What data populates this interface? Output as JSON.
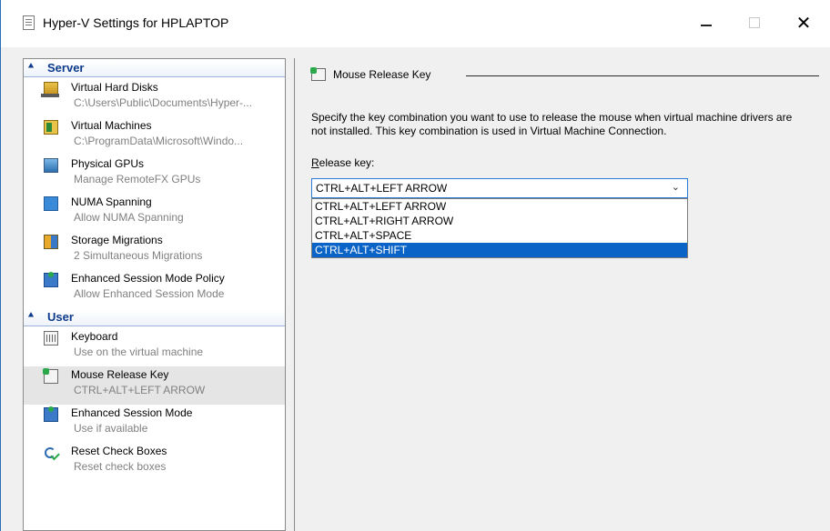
{
  "window": {
    "title": "Hyper-V Settings for HPLAPTOP",
    "close_glyph": "✕"
  },
  "sidebar": {
    "categories": [
      {
        "label": "Server",
        "icon": "chevron-up-icon"
      },
      {
        "label": "User",
        "icon": "chevron-up-icon"
      }
    ],
    "server_items": [
      {
        "title": "Virtual Hard Disks",
        "subtitle": "C:\\Users\\Public\\Documents\\Hyper-...",
        "icon": "hard-disk-icon"
      },
      {
        "title": "Virtual Machines",
        "subtitle": "C:\\ProgramData\\Microsoft\\Windo...",
        "icon": "virtual-machine-icon"
      },
      {
        "title": "Physical GPUs",
        "subtitle": "Manage RemoteFX GPUs",
        "icon": "gpu-icon"
      },
      {
        "title": "NUMA Spanning",
        "subtitle": "Allow NUMA Spanning",
        "icon": "numa-icon"
      },
      {
        "title": "Storage Migrations",
        "subtitle": "2 Simultaneous Migrations",
        "icon": "storage-migration-icon"
      },
      {
        "title": "Enhanced Session Mode Policy",
        "subtitle": "Allow Enhanced Session Mode",
        "icon": "enhanced-session-icon"
      }
    ],
    "user_items": [
      {
        "title": "Keyboard",
        "subtitle": "Use on the virtual machine",
        "icon": "keyboard-icon"
      },
      {
        "title": "Mouse Release Key",
        "subtitle": "CTRL+ALT+LEFT ARROW",
        "icon": "mouse-release-icon",
        "selected": true
      },
      {
        "title": "Enhanced Session Mode",
        "subtitle": "Use if available",
        "icon": "enhanced-session-icon"
      },
      {
        "title": "Reset Check Boxes",
        "subtitle": "Reset check boxes",
        "icon": "reset-icon"
      }
    ]
  },
  "main": {
    "section_title": "Mouse Release Key",
    "description": "Specify the key combination you want to use to release the mouse when virtual machine drivers are not installed. This key combination is used in Virtual Machine Connection.",
    "release_key_label_first": "R",
    "release_key_label_rest": "elease key:",
    "combo_value": "CTRL+ALT+LEFT ARROW",
    "combo_chevron": "⌄",
    "options": [
      {
        "label": "CTRL+ALT+LEFT ARROW",
        "highlighted": false
      },
      {
        "label": "CTRL+ALT+RIGHT ARROW",
        "highlighted": false
      },
      {
        "label": "CTRL+ALT+SPACE",
        "highlighted": false
      },
      {
        "label": "CTRL+ALT+SHIFT",
        "highlighted": true
      }
    ]
  }
}
